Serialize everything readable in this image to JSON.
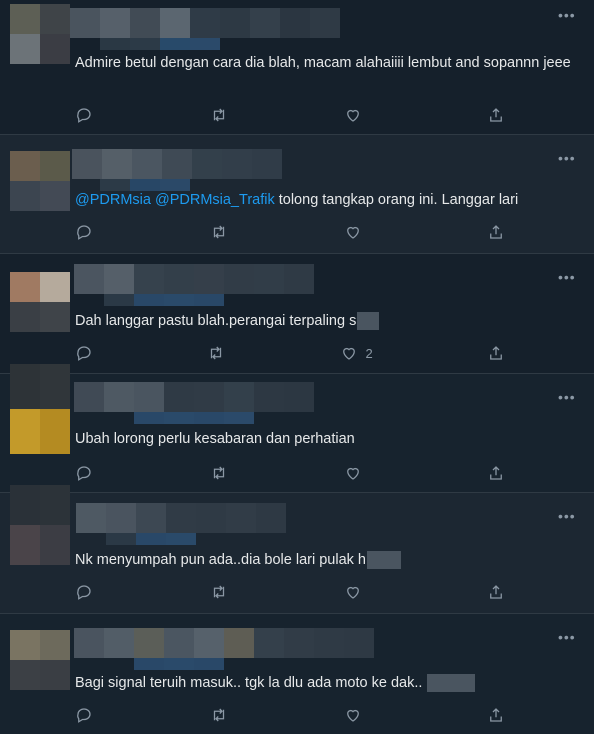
{
  "tweets": [
    {
      "text": "Admire betul dengan cara dia blah, macam alahaiiii lembut and sopannn jeee",
      "likes": ""
    },
    {
      "mentions": [
        "@PDRMsia",
        "@PDRMsia_Trafik"
      ],
      "text": " tolong tangkap orang ini. Langgar lari",
      "likes": ""
    },
    {
      "text": "Dah langgar pastu blah.perangai terpaling s",
      "likes": "2"
    },
    {
      "text": "Ubah lorong perlu kesabaran dan perhatian",
      "likes": ""
    },
    {
      "text": "Nk menyumpah pun ada..dia bole lari pulak h",
      "likes": ""
    },
    {
      "text": "Bagi signal teruih masuk.. tgk la dlu ada moto ke dak..",
      "likes": ""
    }
  ],
  "icons": {
    "more": "more-icon",
    "reply": "reply-icon",
    "retweet": "retweet-icon",
    "like": "like-icon",
    "share": "share-icon"
  },
  "colors": {
    "background": "#15202b",
    "text": "#e7e9ea",
    "mention": "#1d9bf0",
    "icon": "#8b98a5"
  }
}
